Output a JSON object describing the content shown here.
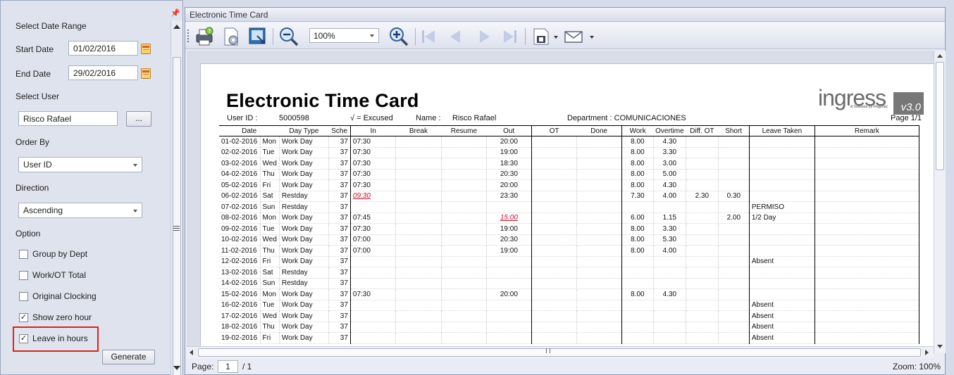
{
  "left_panel": {
    "pin_glyph": "📌",
    "select_date_range": "Select Date Range",
    "start_date_label": "Start Date",
    "start_date_value": "01/02/2016",
    "end_date_label": "End Date",
    "end_date_value": "29/02/2016",
    "select_user_label": "Select User",
    "user_value": "Risco Rafael",
    "browse_label": "...",
    "order_by_label": "Order By",
    "order_by_value": "User ID",
    "direction_label": "Direction",
    "direction_value": "Ascending",
    "option_label": "Option",
    "options": [
      {
        "label": "Group by Dept",
        "checked": false
      },
      {
        "label": "Work/OT Total",
        "checked": false
      },
      {
        "label": "Original Clocking",
        "checked": false
      },
      {
        "label": "Show zero hour",
        "checked": true
      },
      {
        "label": "Leave in hours",
        "checked": true
      }
    ],
    "generate_label": "Generate",
    "highlight_color": "#e0201b"
  },
  "viewer": {
    "title": "Electronic Time Card",
    "zoom_value": "100%",
    "status_page_label": "Page:",
    "status_page_value": "1",
    "status_page_total": "/ 1",
    "status_zoom": "Zoom: 100%",
    "toolbar_icons": [
      "print-icon",
      "page-setup-icon",
      "export-icon",
      "zoom-out-icon",
      "zoom-in-icon",
      "first-page-icon",
      "previous-page-icon",
      "next-page-icon",
      "last-page-icon",
      "save-icon",
      "email-icon"
    ]
  },
  "report": {
    "title": "Electronic Time Card",
    "logo_text": "ingress",
    "logo_sub": "A Software by Fingertec",
    "logo_version": "v3.0",
    "user_id_label": "User ID :",
    "user_id": "5000598",
    "excused_legend": "√ =  Excused",
    "name_label": "Name :",
    "name": "Risco Rafael",
    "department": "Department : COMUNICACIONES",
    "page": "Page 1/1",
    "columns": [
      "Date",
      "Day Type",
      "Sche",
      "In",
      "Break",
      "Resume",
      "Out",
      "OT",
      "Done",
      "Work",
      "Overtime",
      "Diff. OT",
      "Short",
      "Leave Taken",
      "Remark"
    ],
    "rows": [
      {
        "date": "01-02-2016",
        "dow": "Mon",
        "type": "Work Day",
        "sch": "37",
        "in": "07:30",
        "in_late": false,
        "brk": "",
        "res": "",
        "out": "20:00",
        "out_late": false,
        "ot": "",
        "done": "",
        "work": "8.00",
        "overtime": "4.30",
        "diff": "",
        "short": "",
        "leave": "",
        "remark": ""
      },
      {
        "date": "02-02-2016",
        "dow": "Tue",
        "type": "Work Day",
        "sch": "37",
        "in": "07:30",
        "in_late": false,
        "brk": "",
        "res": "",
        "out": "19:00",
        "out_late": false,
        "ot": "",
        "done": "",
        "work": "8.00",
        "overtime": "3.30",
        "diff": "",
        "short": "",
        "leave": "",
        "remark": ""
      },
      {
        "date": "03-02-2016",
        "dow": "Wed",
        "type": "Work Day",
        "sch": "37",
        "in": "07:30",
        "in_late": false,
        "brk": "",
        "res": "",
        "out": "18:30",
        "out_late": false,
        "ot": "",
        "done": "",
        "work": "8.00",
        "overtime": "3.00",
        "diff": "",
        "short": "",
        "leave": "",
        "remark": ""
      },
      {
        "date": "04-02-2016",
        "dow": "Thu",
        "type": "Work Day",
        "sch": "37",
        "in": "07:30",
        "in_late": false,
        "brk": "",
        "res": "",
        "out": "20:30",
        "out_late": false,
        "ot": "",
        "done": "",
        "work": "8.00",
        "overtime": "5.00",
        "diff": "",
        "short": "",
        "leave": "",
        "remark": ""
      },
      {
        "date": "05-02-2016",
        "dow": "Fri",
        "type": "Work Day",
        "sch": "37",
        "in": "07:30",
        "in_late": false,
        "brk": "",
        "res": "",
        "out": "20:00",
        "out_late": false,
        "ot": "",
        "done": "",
        "work": "8.00",
        "overtime": "4.30",
        "diff": "",
        "short": "",
        "leave": "",
        "remark": ""
      },
      {
        "date": "06-02-2016",
        "dow": "Sat",
        "type": "Restday",
        "sch": "37",
        "in": "09:30",
        "in_late": true,
        "brk": "",
        "res": "",
        "out": "23:30",
        "out_late": false,
        "ot": "",
        "done": "",
        "work": "7.30",
        "overtime": "4.00",
        "diff": "2.30",
        "short": "0.30",
        "leave": "",
        "remark": ""
      },
      {
        "date": "07-02-2016",
        "dow": "Sun",
        "type": "Restday",
        "sch": "37",
        "in": "",
        "in_late": false,
        "brk": "",
        "res": "",
        "out": "",
        "out_late": false,
        "ot": "",
        "done": "",
        "work": "",
        "overtime": "",
        "diff": "",
        "short": "",
        "leave": "PERMISO",
        "remark": ""
      },
      {
        "date": "08-02-2016",
        "dow": "Mon",
        "type": "Work Day",
        "sch": "37",
        "in": "07:45",
        "in_late": false,
        "brk": "",
        "res": "",
        "out": "15:00",
        "out_late": true,
        "ot": "",
        "done": "",
        "work": "6.00",
        "overtime": "1.15",
        "diff": "",
        "short": "2.00",
        "leave": "1/2 Day",
        "remark": ""
      },
      {
        "date": "09-02-2016",
        "dow": "Tue",
        "type": "Work Day",
        "sch": "37",
        "in": "07:30",
        "in_late": false,
        "brk": "",
        "res": "",
        "out": "19:00",
        "out_late": false,
        "ot": "",
        "done": "",
        "work": "8.00",
        "overtime": "3.30",
        "diff": "",
        "short": "",
        "leave": "",
        "remark": ""
      },
      {
        "date": "10-02-2016",
        "dow": "Wed",
        "type": "Work Day",
        "sch": "37",
        "in": "07:00",
        "in_late": false,
        "brk": "",
        "res": "",
        "out": "20:30",
        "out_late": false,
        "ot": "",
        "done": "",
        "work": "8.00",
        "overtime": "5.30",
        "diff": "",
        "short": "",
        "leave": "",
        "remark": ""
      },
      {
        "date": "11-02-2016",
        "dow": "Thu",
        "type": "Work Day",
        "sch": "37",
        "in": "07:00",
        "in_late": false,
        "brk": "",
        "res": "",
        "out": "19:00",
        "out_late": false,
        "ot": "",
        "done": "",
        "work": "8.00",
        "overtime": "4.00",
        "diff": "",
        "short": "",
        "leave": "",
        "remark": ""
      },
      {
        "date": "12-02-2016",
        "dow": "Fri",
        "type": "Work Day",
        "sch": "37",
        "in": "",
        "in_late": false,
        "brk": "",
        "res": "",
        "out": "",
        "out_late": false,
        "ot": "",
        "done": "",
        "work": "",
        "overtime": "",
        "diff": "",
        "short": "",
        "leave": "Absent",
        "remark": ""
      },
      {
        "date": "13-02-2016",
        "dow": "Sat",
        "type": "Restday",
        "sch": "37",
        "in": "",
        "in_late": false,
        "brk": "",
        "res": "",
        "out": "",
        "out_late": false,
        "ot": "",
        "done": "",
        "work": "",
        "overtime": "",
        "diff": "",
        "short": "",
        "leave": "",
        "remark": ""
      },
      {
        "date": "14-02-2016",
        "dow": "Sun",
        "type": "Restday",
        "sch": "37",
        "in": "",
        "in_late": false,
        "brk": "",
        "res": "",
        "out": "",
        "out_late": false,
        "ot": "",
        "done": "",
        "work": "",
        "overtime": "",
        "diff": "",
        "short": "",
        "leave": "",
        "remark": ""
      },
      {
        "date": "15-02-2016",
        "dow": "Mon",
        "type": "Work Day",
        "sch": "37",
        "in": "07:30",
        "in_late": false,
        "brk": "",
        "res": "",
        "out": "20:00",
        "out_late": false,
        "ot": "",
        "done": "",
        "work": "8.00",
        "overtime": "4.30",
        "diff": "",
        "short": "",
        "leave": "",
        "remark": ""
      },
      {
        "date": "16-02-2016",
        "dow": "Tue",
        "type": "Work Day",
        "sch": "37",
        "in": "",
        "in_late": false,
        "brk": "",
        "res": "",
        "out": "",
        "out_late": false,
        "ot": "",
        "done": "",
        "work": "",
        "overtime": "",
        "diff": "",
        "short": "",
        "leave": "Absent",
        "remark": ""
      },
      {
        "date": "17-02-2016",
        "dow": "Wed",
        "type": "Work Day",
        "sch": "37",
        "in": "",
        "in_late": false,
        "brk": "",
        "res": "",
        "out": "",
        "out_late": false,
        "ot": "",
        "done": "",
        "work": "",
        "overtime": "",
        "diff": "",
        "short": "",
        "leave": "Absent",
        "remark": ""
      },
      {
        "date": "18-02-2016",
        "dow": "Thu",
        "type": "Work Day",
        "sch": "37",
        "in": "",
        "in_late": false,
        "brk": "",
        "res": "",
        "out": "",
        "out_late": false,
        "ot": "",
        "done": "",
        "work": "",
        "overtime": "",
        "diff": "",
        "short": "",
        "leave": "Absent",
        "remark": ""
      },
      {
        "date": "19-02-2016",
        "dow": "Fri",
        "type": "Work Day",
        "sch": "37",
        "in": "",
        "in_late": false,
        "brk": "",
        "res": "",
        "out": "",
        "out_late": false,
        "ot": "",
        "done": "",
        "work": "",
        "overtime": "",
        "diff": "",
        "short": "",
        "leave": "Absent",
        "remark": ""
      }
    ]
  }
}
